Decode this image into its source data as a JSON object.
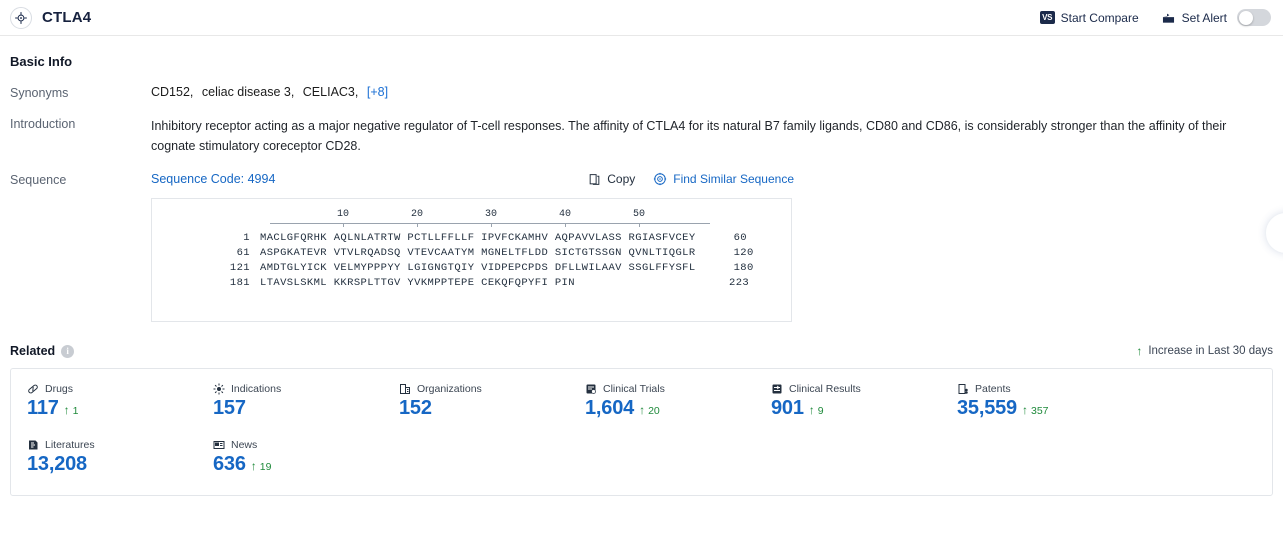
{
  "header": {
    "title": "CTLA4",
    "logo_icon": "target-icon",
    "actions": [
      {
        "label": "Start Compare",
        "icon": "vs-badge-icon",
        "badge_text": "VS"
      },
      {
        "label": "Set Alert",
        "icon": "alert-bell-icon",
        "toggle_on": false
      }
    ]
  },
  "basic_info": {
    "title": "Basic Info",
    "synonyms": {
      "label": "Synonyms",
      "items": [
        "CD152,",
        "celiac disease 3,",
        "CELIAC3,"
      ],
      "more_link": "[+8]"
    },
    "introduction": {
      "label": "Introduction",
      "text": "Inhibitory receptor acting as a major negative regulator of T-cell responses. The affinity of CTLA4 for its natural B7 family ligands, CD80 and CD86, is considerably stronger than the affinity of their cognate stimulatory coreceptor CD28."
    },
    "sequence": {
      "label": "Sequence",
      "code_label": "Sequence Code: 4994",
      "copy_label": "Copy",
      "copy_icon": "copy-icon",
      "find_similar_label": "Find Similar Sequence",
      "find_similar_icon": "target-icon",
      "ruler_ticks": [
        "10",
        "20",
        "30",
        "40",
        "50"
      ],
      "rows": [
        {
          "start": "1",
          "residues": "MACLGFQRHK AQLNLATRTW PCTLLFFLLF IPVFCKAMHV AQPAVVLASS RGIASFVCEY",
          "end": "60"
        },
        {
          "start": "61",
          "residues": "ASPGKATEVR VTVLRQADSQ VTEVCAATYM MGNELTFLDD SICTGTSSGN QVNLTIQGLR",
          "end": "120"
        },
        {
          "start": "121",
          "residues": "AMDTGLYICK VELMYPPPYY LGIGNGTQIY VIDPEPCPDS DFLLWILAAV SSGLFFYSFL",
          "end": "180"
        },
        {
          "start": "181",
          "residues": "LTAVSLSKML KKRSPLTTGV YVKMPPTEPE CEKQFQPYFI PIN",
          "end": "223"
        }
      ]
    }
  },
  "related": {
    "title": "Related",
    "info_icon": "info-icon",
    "legend": "Increase in Last 30 days",
    "legend_icon": "arrow-up-icon",
    "cards": [
      {
        "label": "Drugs",
        "icon": "pill-icon",
        "value": "117",
        "delta": "1"
      },
      {
        "label": "Indications",
        "icon": "virus-icon",
        "value": "157",
        "delta": ""
      },
      {
        "label": "Organizations",
        "icon": "building-icon",
        "value": "152",
        "delta": ""
      },
      {
        "label": "Clinical Trials",
        "icon": "clinical-trial-icon",
        "value": "1,604",
        "delta": "20"
      },
      {
        "label": "Clinical Results",
        "icon": "clinical-result-icon",
        "value": "901",
        "delta": "9"
      },
      {
        "label": "Patents",
        "icon": "patent-icon",
        "value": "35,559",
        "delta": "357"
      },
      {
        "label": "Literatures",
        "icon": "book-icon",
        "value": "13,208",
        "delta": ""
      },
      {
        "label": "News",
        "icon": "news-icon",
        "value": "636",
        "delta": "19"
      }
    ]
  },
  "colors": {
    "accent_blue": "#1667c4",
    "increase_green": "#1f8a3b",
    "title_navy": "#16213e",
    "border_gray": "#e3e6ea"
  }
}
